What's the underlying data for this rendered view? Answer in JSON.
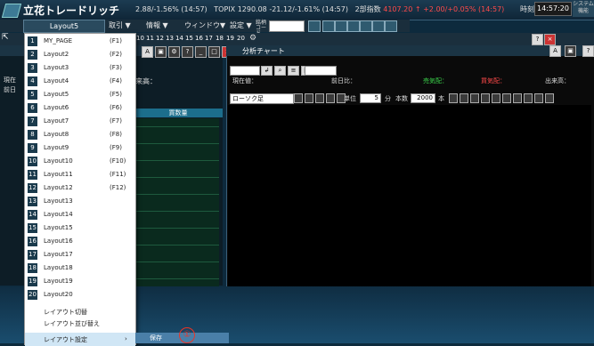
{
  "app": {
    "title": "立花トレードリッチ",
    "layout": "Layout5"
  },
  "ticker": {
    "nikkei": "2.88/-1.56% (14:57)",
    "topix": "TOPIX 1290.08",
    "topix_change": "-21.12/-1.61% (14:57)",
    "second": "2部指数",
    "second_change": "4107.20 ↑ +2.00/+0.05% (14:57)"
  },
  "clock": {
    "label": "時刻",
    "time": "14:57:20"
  },
  "system_button": "システム 機能",
  "menu": [
    "取引 ▼",
    "情報 ▼",
    "ウィンドウ▼",
    "設定 ▼"
  ],
  "code_label": "銘柄コード",
  "num_tabs": [
    "10",
    "11",
    "12",
    "13",
    "14",
    "15",
    "16",
    "17",
    "18",
    "19",
    "20"
  ],
  "dropdown": {
    "layouts": [
      {
        "num": "1",
        "label": "MY_PAGE",
        "key": "(F1)"
      },
      {
        "num": "2",
        "label": "Layout2",
        "key": "(F2)"
      },
      {
        "num": "3",
        "label": "Layout3",
        "key": "(F3)"
      },
      {
        "num": "4",
        "label": "Layout4",
        "key": "(F4)"
      },
      {
        "num": "5",
        "label": "Layout5",
        "key": "(F5)"
      },
      {
        "num": "6",
        "label": "Layout6",
        "key": "(F6)"
      },
      {
        "num": "7",
        "label": "Layout7",
        "key": "(F7)"
      },
      {
        "num": "8",
        "label": "Layout8",
        "key": "(F8)"
      },
      {
        "num": "9",
        "label": "Layout9",
        "key": "(F9)"
      },
      {
        "num": "10",
        "label": "Layout10",
        "key": "(F10)"
      },
      {
        "num": "11",
        "label": "Layout11",
        "key": "(F11)"
      },
      {
        "num": "12",
        "label": "Layout12",
        "key": "(F12)"
      },
      {
        "num": "13",
        "label": "Layout13",
        "key": ""
      },
      {
        "num": "14",
        "label": "Layout14",
        "key": ""
      },
      {
        "num": "15",
        "label": "Layout15",
        "key": ""
      },
      {
        "num": "16",
        "label": "Layout16",
        "key": ""
      },
      {
        "num": "17",
        "label": "Layout17",
        "key": ""
      },
      {
        "num": "18",
        "label": "Layout18",
        "key": ""
      },
      {
        "num": "19",
        "label": "Layout19",
        "key": ""
      },
      {
        "num": "20",
        "label": "Layout20",
        "key": ""
      }
    ],
    "switch": "レイアウト切替",
    "reorder": "レイアウト並び替え",
    "settings": "レイアウト設定",
    "submenu_save": "保存",
    "annotation": "①"
  },
  "left_panel": {
    "labels": [
      "現在",
      "前日"
    ],
    "grid_header": "買数量",
    "ago": "来高："
  },
  "chart": {
    "title": "分析チャート",
    "current": "現在値：",
    "prev": "前日比：",
    "sell": "売気配：",
    "buy": "買気配：",
    "volume": "出来高：",
    "type": "ローソク足",
    "unit_label": "単位",
    "unit_value": "5",
    "unit_suffix": "分",
    "count_label": "本数",
    "count_value": "2000",
    "count_suffix": "本"
  },
  "colors": {
    "accent_red": "#ff4a4a",
    "sell_green": "#3ad14a",
    "buy_red": "#ff4a4a"
  }
}
